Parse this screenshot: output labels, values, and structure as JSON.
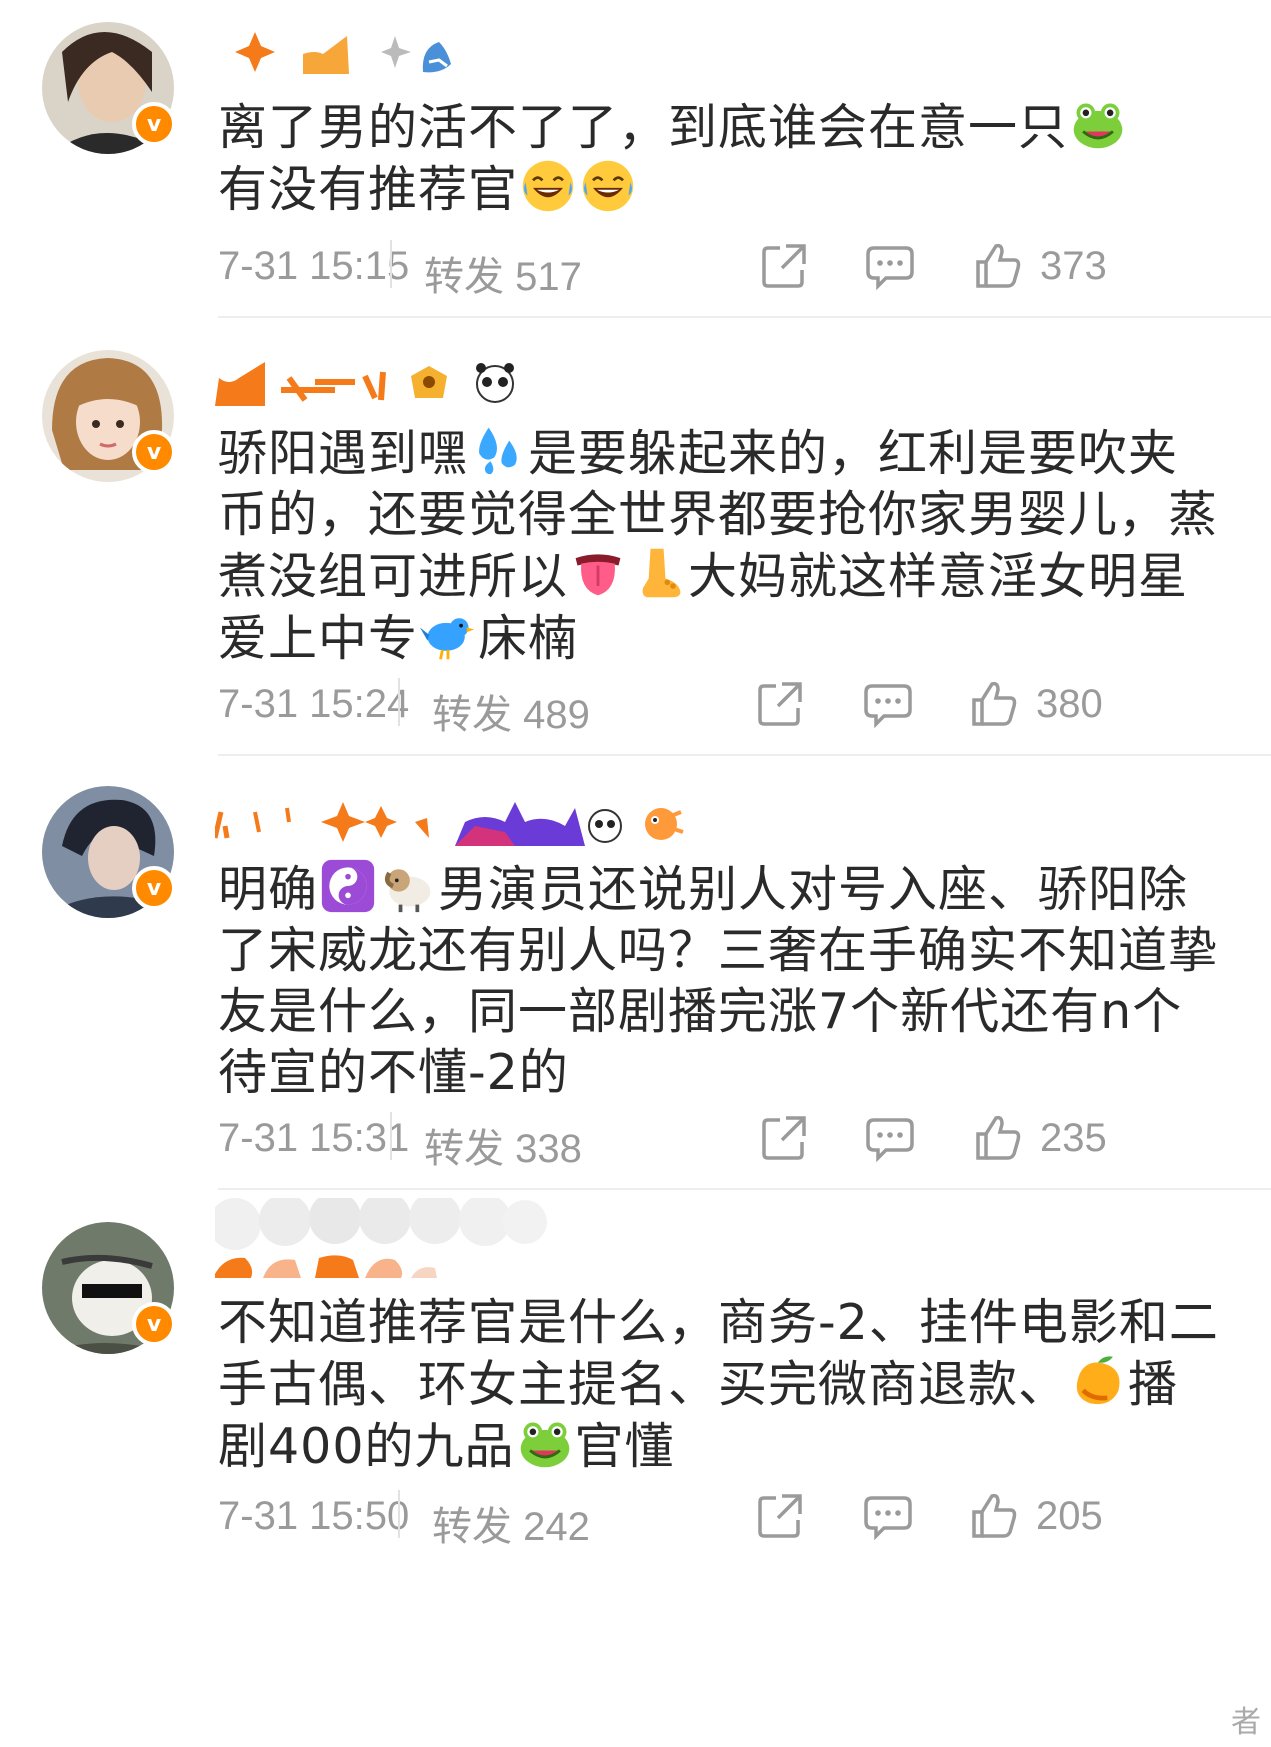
{
  "comments": [
    {
      "text_a": "离了男的活不了了，到底谁会在意一只",
      "emoji_a": "frog-emoji",
      "text_b": "有没有推荐官",
      "emoji_b": "laughing-tears-emoji",
      "badge": "v",
      "time": "7-31 15:15",
      "repost_label": "转发",
      "repost_count": "517",
      "like_count": "373"
    },
    {
      "text_a": "骄阳遇到嘿",
      "emoji_a": "sweat-droplets-emoji",
      "text_b": "是要躲起来的，红利是要吹夹币的，还要觉得全世界都要抢你家男婴儿，蒸煮没组可进所以",
      "emoji_b1": "tongue-emoji",
      "emoji_b2": "foot-emoji",
      "text_c": "大妈就这样意淫女明星爱上中专",
      "emoji_c": "bird-emoji",
      "text_d": "床楠",
      "badge": "v",
      "time": "7-31 15:24",
      "repost_label": "转发",
      "repost_count": "489",
      "like_count": "380"
    },
    {
      "text_a": "明确",
      "emoji_a1": "yin-yang-emoji",
      "emoji_a2": "ram-emoji",
      "text_b": "男演员还说别人对号入座、骄阳除了宋威龙还有别人吗？三奢在手确实不知道挚友是什么，同一部剧播完涨7个新代还有n个待宣的不懂-2的",
      "badge": "v",
      "time": "7-31 15:31",
      "repost_label": "转发",
      "repost_count": "338",
      "like_count": "235"
    },
    {
      "text_a": "不知道推荐官是什么，商务-2、挂件电影和二手古偶、环女主提名、买完微商退款、",
      "emoji_a": "mango-emoji",
      "text_b": "播剧400的九品",
      "emoji_b": "frog-emoji",
      "text_c": "官懂",
      "badge": "v",
      "time": "7-31 15:50",
      "repost_label": "转发",
      "repost_count": "242",
      "like_count": "205"
    }
  ],
  "corner_text": "者",
  "colors": {
    "badge": "#ff8a00",
    "meta": "#9a9a9a",
    "divider": "#eeeeee"
  }
}
